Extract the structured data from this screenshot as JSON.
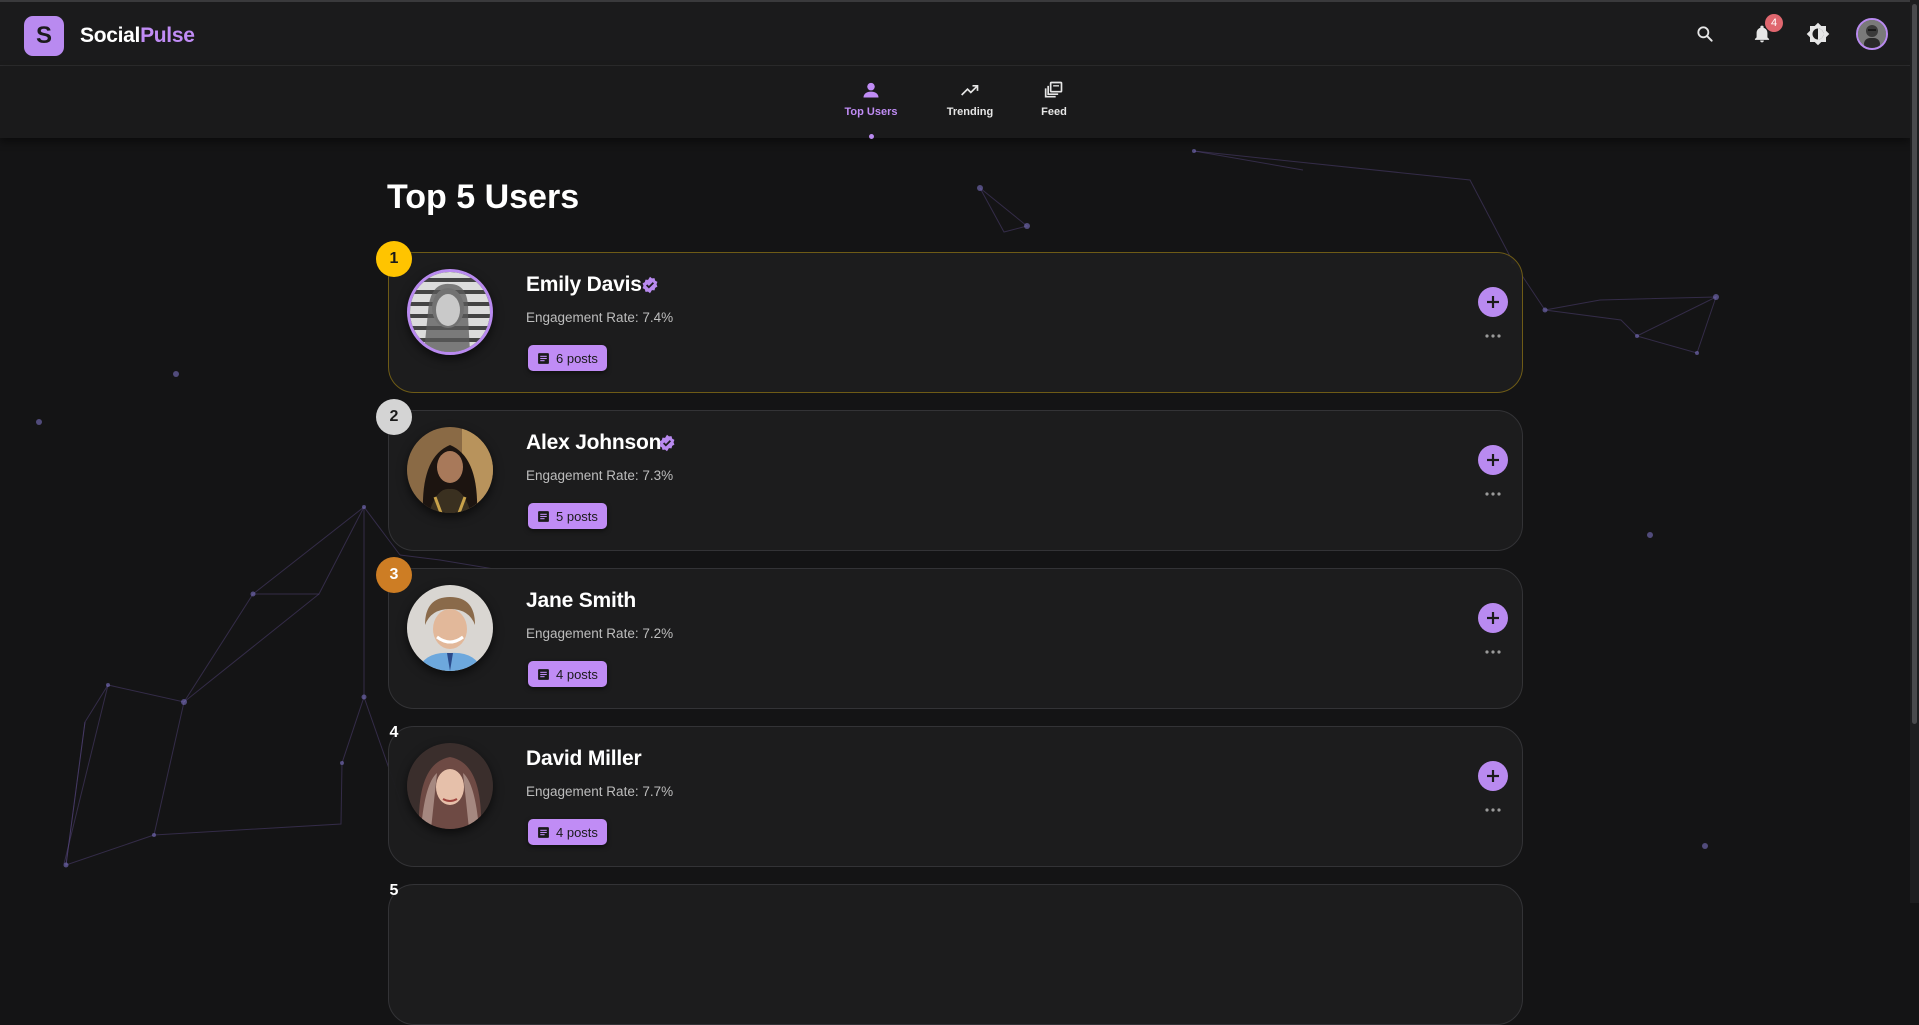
{
  "app": {
    "brand_first": "Social",
    "brand_second": "Pulse",
    "logo_letter": "S",
    "notification_count": "4",
    "accent_color": "#b98af0"
  },
  "icons": {
    "search": "search-icon",
    "notifications": "bell-icon",
    "theme": "brightness-icon",
    "profile": "avatar"
  },
  "tabs": [
    {
      "label": "Top Users",
      "icon": "person-icon",
      "active": true
    },
    {
      "label": "Trending",
      "icon": "trending-up-icon",
      "active": false
    },
    {
      "label": "Feed",
      "icon": "library-icon",
      "active": false
    }
  ],
  "page": {
    "title": "Top 5 Users"
  },
  "users": [
    {
      "rank": "1",
      "name": "Emily Davis",
      "verified": true,
      "engagement": "Engagement Rate: 7.4%",
      "posts": "6 posts",
      "rank_style": "gold"
    },
    {
      "rank": "2",
      "name": "Alex Johnson",
      "verified": true,
      "engagement": "Engagement Rate: 7.3%",
      "posts": "5 posts",
      "rank_style": "silver"
    },
    {
      "rank": "3",
      "name": "Jane Smith",
      "verified": false,
      "engagement": "Engagement Rate: 7.2%",
      "posts": "4 posts",
      "rank_style": "bronze"
    },
    {
      "rank": "4",
      "name": "David Miller",
      "verified": false,
      "engagement": "Engagement Rate: 7.7%",
      "posts": "4 posts",
      "rank_style": "plain"
    },
    {
      "rank": "5",
      "rank_style": "plain"
    }
  ]
}
